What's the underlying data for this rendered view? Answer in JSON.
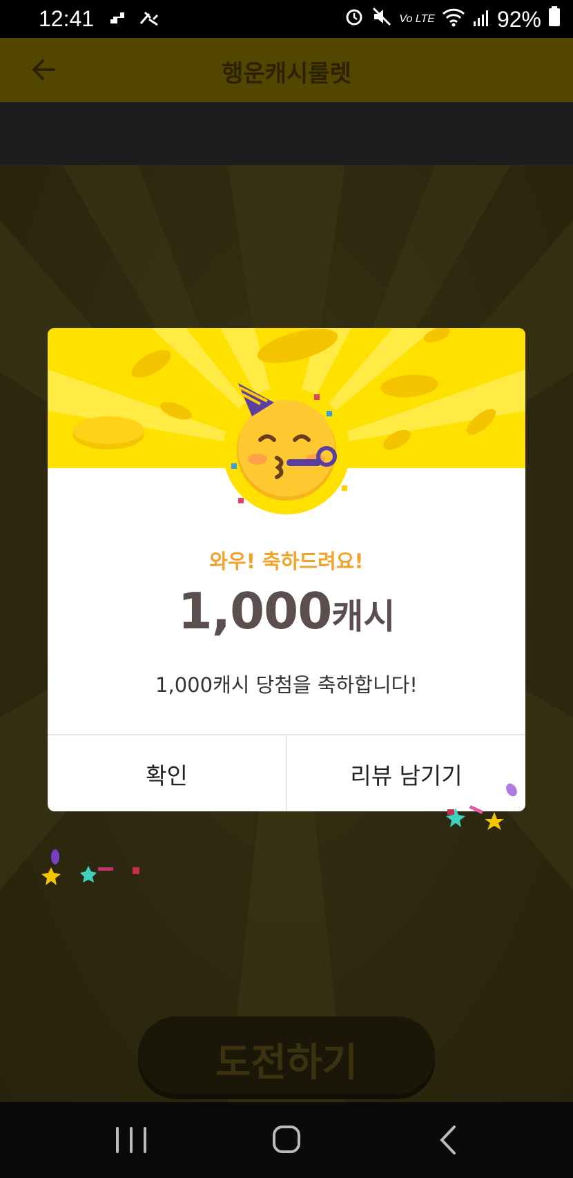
{
  "status": {
    "time": "12:41",
    "network": "Vo LTE",
    "battery": "92%",
    "left_icons": [
      "notification-icon",
      "bluetooth-icon"
    ],
    "right_icons": [
      "alarm-icon",
      "mute-icon",
      "volte-icon",
      "wifi-icon",
      "signal-icon",
      "battery-icon"
    ]
  },
  "header": {
    "title": "행운캐시룰렛",
    "back_icon": "back-arrow-icon"
  },
  "dialog": {
    "subtitle": "와우! 축하드려요!",
    "amount_number": "1,000",
    "amount_unit": "캐시",
    "message": "1,000캐시 당첨을 축하합니다!",
    "confirm_label": "확인",
    "review_label": "리뷰 남기기",
    "emoji": "partying-face-emoji"
  },
  "game": {
    "challenge_label": "도전하기"
  },
  "nav": {
    "items": [
      "recent-apps-icon",
      "home-icon",
      "back-icon"
    ]
  },
  "colors": {
    "accent_yellow": "#ffe100",
    "subtitle_orange": "#f0a22a",
    "amount_text": "#5b4e4e",
    "dimmed_header": "#524600"
  }
}
